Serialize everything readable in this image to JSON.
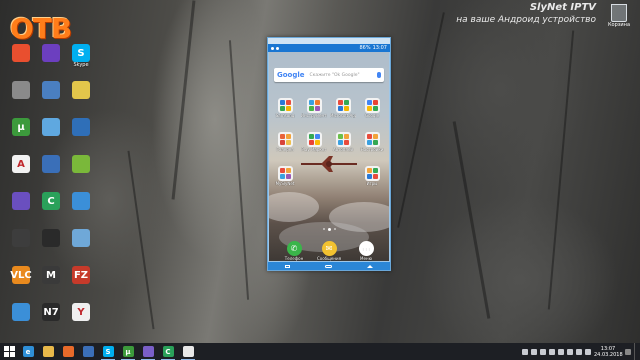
{
  "logo": {
    "text": "OTB"
  },
  "promo": {
    "title": "SlyNet IPTV",
    "subtitle": "на ваше Андроид устройство"
  },
  "recycle_bin": {
    "label": "Корзина"
  },
  "desktop_icons": [
    {
      "label": "",
      "color": "#e94f2f",
      "glyph": "",
      "icon": "browser-icon"
    },
    {
      "label": "",
      "color": "#6c3fbf",
      "glyph": "",
      "icon": "app-icon"
    },
    {
      "label": "Skype",
      "color": "#00aff0",
      "glyph": "S",
      "icon": "skype-icon"
    },
    {
      "label": "",
      "color": "#8a8a8a",
      "glyph": "",
      "icon": "app-icon"
    },
    {
      "label": "",
      "color": "#4a7fc1",
      "glyph": "",
      "icon": "app-icon"
    },
    {
      "label": "",
      "color": "#e3c64b",
      "glyph": "",
      "icon": "folder-icon"
    },
    {
      "label": "",
      "color": "#3c9a3c",
      "glyph": "μ",
      "icon": "utorrent-icon"
    },
    {
      "label": "",
      "color": "#5fa8e0",
      "glyph": "",
      "icon": "app-icon"
    },
    {
      "label": "",
      "color": "#2f6fb8",
      "glyph": "",
      "icon": "app-icon"
    },
    {
      "label": "",
      "color": "#f2f2f2",
      "glyph": "A",
      "icon": "font-icon"
    },
    {
      "label": "",
      "color": "#3a6fb8",
      "glyph": "",
      "icon": "app-icon"
    },
    {
      "label": "",
      "color": "#7ab83a",
      "glyph": "",
      "icon": "app-icon"
    },
    {
      "label": "",
      "color": "#6a4fbf",
      "glyph": "",
      "icon": "app-icon"
    },
    {
      "label": "",
      "color": "#2aa15a",
      "glyph": "C",
      "icon": "camtasia-icon"
    },
    {
      "label": "",
      "color": "#3b8fd8",
      "glyph": "",
      "icon": "app-icon"
    },
    {
      "label": "",
      "color": "#3d3d3d",
      "glyph": "",
      "icon": "app-icon"
    },
    {
      "label": "",
      "color": "#2a2a2a",
      "glyph": "",
      "icon": "clapper-icon"
    },
    {
      "label": "",
      "color": "#6fa8d8",
      "glyph": "",
      "icon": "app-icon"
    },
    {
      "label": "",
      "color": "#e98a1e",
      "glyph": "VLC",
      "icon": "vlc-icon"
    },
    {
      "label": "",
      "color": "#3a3a3a",
      "glyph": "M",
      "icon": "app-icon"
    },
    {
      "label": "",
      "color": "#c63a2a",
      "glyph": "FZ",
      "icon": "filezilla-icon"
    },
    {
      "label": "",
      "color": "#3b8fd8",
      "glyph": "",
      "icon": "app-icon"
    },
    {
      "label": "",
      "color": "#2a2a2a",
      "glyph": "N7",
      "icon": "app-icon"
    },
    {
      "label": "",
      "color": "#f0f0f0",
      "glyph": "Y",
      "icon": "yandex-icon"
    }
  ],
  "phone": {
    "status_time": "13:07",
    "battery": "86%",
    "search_logo": "Google",
    "search_hint": "Скажите \"Ok Google\"",
    "apps": [
      {
        "name": "Samsung",
        "colors": [
          "#2a78d6",
          "#e84b3c",
          "#35a853",
          "#f2b400"
        ]
      },
      {
        "name": "Инструменты",
        "colors": [
          "#3aa0e0",
          "#f27b2a",
          "#49b34a",
          "#9b59b6"
        ]
      },
      {
        "name": "Microsoft Apps",
        "colors": [
          "#e84b3c",
          "#35a853",
          "#2a78d6",
          "#f2b400"
        ]
      },
      {
        "name": "Google",
        "colors": [
          "#4285f4",
          "#ea4335",
          "#fbbc05",
          "#34a853"
        ]
      },
      {
        "name": "Галерея",
        "colors": [
          "#e8623a",
          "#f2a33a",
          "#d8453a",
          "#f0c04a"
        ]
      },
      {
        "name": "Play Маркет",
        "colors": [
          "#34a853",
          "#4285f4",
          "#ea4335",
          "#fbbc05"
        ]
      },
      {
        "name": "Автоплей",
        "colors": [
          "#6bbf4a",
          "#f2a33a",
          "#3aa0e0",
          "#e84b3c"
        ]
      },
      {
        "name": "Настройки",
        "colors": [
          "#e84b3c",
          "#f2a33a",
          "#3aa0e0",
          "#34a853"
        ]
      },
      {
        "name": "MySlyNet",
        "colors": [
          "#e84b3c",
          "#f2a33a",
          "#3aa0e0",
          "#9b59b6"
        ]
      },
      {
        "name": "Игры",
        "colors": [
          "#f2a33a",
          "#34a853",
          "#2a78d6",
          "#e84b3c"
        ]
      }
    ],
    "dock": [
      {
        "name": "Телефон",
        "color": "#3ab54a",
        "glyph": "✆"
      },
      {
        "name": "Сообщения",
        "color": "#f2c230",
        "glyph": "✉"
      },
      {
        "name": "Меню",
        "color": "#ffffff",
        "glyph": "⋮⋮⋮"
      }
    ]
  },
  "taskbar": {
    "items": [
      {
        "icon": "edge-icon",
        "color": "#2f8fd8",
        "glyph": "e"
      },
      {
        "icon": "folder-icon",
        "color": "#e8b84a",
        "glyph": ""
      },
      {
        "icon": "firefox-icon",
        "color": "#e86a2a",
        "glyph": ""
      },
      {
        "icon": "windows-media-icon",
        "color": "#3b6fb8",
        "glyph": ""
      },
      {
        "icon": "skype-icon",
        "color": "#00aff0",
        "glyph": "S"
      },
      {
        "icon": "utorrent-icon",
        "color": "#3c9a3c",
        "glyph": "μ"
      },
      {
        "icon": "app-icon",
        "color": "#7a5fc8",
        "glyph": ""
      },
      {
        "icon": "camtasia-icon",
        "color": "#2aa15a",
        "glyph": "C"
      },
      {
        "icon": "recorder-icon",
        "color": "#e8e8e8",
        "glyph": ""
      }
    ],
    "clock_time": "13:07",
    "clock_date": "24.03.2018"
  }
}
